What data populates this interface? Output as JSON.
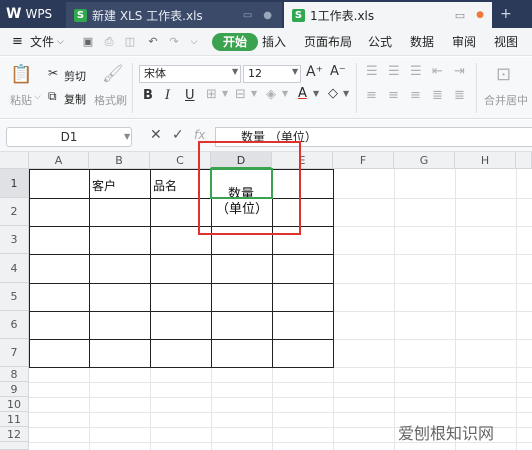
{
  "tabs": {
    "app": "WPS",
    "doc1": "新建 XLS 工作表.xls",
    "doc2": "1工作表.xls"
  },
  "menu": {
    "file": "文件",
    "start": "开始",
    "insert": "插入",
    "layout": "页面布局",
    "formula": "公式",
    "data": "数据",
    "review": "审阅",
    "view": "视图"
  },
  "ribbon": {
    "paste": "粘贴",
    "cut": "剪切",
    "copy": "复制",
    "format_painter": "格式刷",
    "font_name": "宋体",
    "font_size": "12",
    "merge_center": "合并居中",
    "bold": "B",
    "italic": "I",
    "underline": "U"
  },
  "formula_bar": {
    "name_box": "D1",
    "fx": "fx",
    "content": "数量  （单位）"
  },
  "grid": {
    "columns": [
      "A",
      "B",
      "C",
      "D",
      "E",
      "F",
      "G",
      "H"
    ],
    "rows": [
      "1",
      "2",
      "3",
      "4",
      "5",
      "6",
      "7",
      "8",
      "9",
      "10",
      "11",
      "12"
    ],
    "cells": {
      "B1": "客户",
      "C1": "品名",
      "D1_line1": "数量",
      "D1_line2": "（单位）"
    }
  },
  "watermark": "爱刨根知识网",
  "colors": {
    "accent": "#3ba34f",
    "highlight": "#e0322c",
    "titlebar": "#2b3a58"
  }
}
